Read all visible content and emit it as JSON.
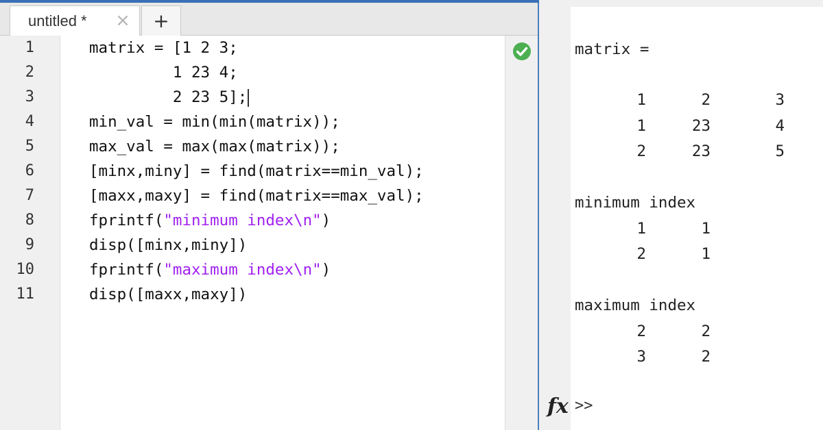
{
  "editor": {
    "tab_label": "untitled *",
    "new_tab_label": "+",
    "line_numbers": [
      "1",
      "2",
      "3",
      "4",
      "5",
      "6",
      "7",
      "8",
      "9",
      "10",
      "11"
    ],
    "lines": [
      {
        "pre": "matrix = [1 2 3;",
        "str": "",
        "post": ""
      },
      {
        "pre": "         1 23 4;",
        "str": "",
        "post": ""
      },
      {
        "pre": "         2 23 5];",
        "str": "",
        "post": ""
      },
      {
        "pre": "min_val = min(min(matrix));",
        "str": "",
        "post": ""
      },
      {
        "pre": "max_val = max(max(matrix));",
        "str": "",
        "post": ""
      },
      {
        "pre": "[minx,miny] = find(matrix==min_val);",
        "str": "",
        "post": ""
      },
      {
        "pre": "[maxx,maxy] = find(matrix==max_val);",
        "str": "",
        "post": ""
      },
      {
        "pre": "fprintf(",
        "str": "\"minimum index\\n\"",
        "post": ")"
      },
      {
        "pre": "disp([minx,miny])",
        "str": "",
        "post": ""
      },
      {
        "pre": "fprintf(",
        "str": "\"maximum index\\n\"",
        "post": ")"
      },
      {
        "pre": "disp([maxx,maxy])",
        "str": "",
        "post": ""
      }
    ],
    "status_icon": "check-circle-icon",
    "status_color": "#4caf50",
    "string_color": "#a020f0"
  },
  "command_window": {
    "matrix_label": "matrix =",
    "matrix_rows": [
      [
        "1",
        "2",
        "3"
      ],
      [
        "1",
        "23",
        "4"
      ],
      [
        "2",
        "23",
        "5"
      ]
    ],
    "min_label": "minimum index",
    "min_rows": [
      [
        "1",
        "1"
      ],
      [
        "2",
        "1"
      ]
    ],
    "max_label": "maximum index",
    "max_rows": [
      [
        "2",
        "2"
      ],
      [
        "3",
        "2"
      ]
    ],
    "fx_label": "fx",
    "prompt": ">>"
  }
}
